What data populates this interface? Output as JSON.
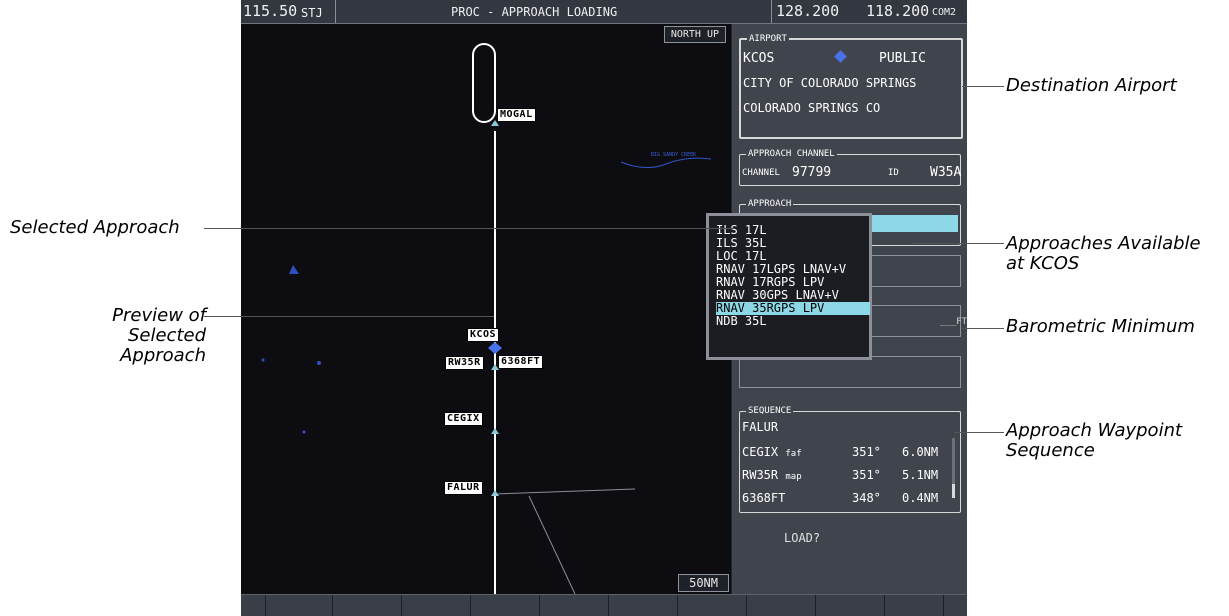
{
  "top_bar": {
    "nav_freq": "115.50",
    "nav_id": "STJ",
    "title": "PROC - APPROACH LOADING",
    "com_active": "128.200",
    "com_standby": "118.200",
    "com_label": "COM2"
  },
  "map": {
    "orientation": "NORTH UP",
    "range": "50NM",
    "waypoints": {
      "mogal": "MOGAL",
      "kcos": "KCOS",
      "rw35r": "RW35R",
      "elev": "6368FT",
      "cegix": "CEGIX",
      "falur": "FALUR"
    },
    "creek_label": "BIG SANDY CREEK"
  },
  "airport": {
    "title": "AIRPORT",
    "id": "KCOS",
    "type": "PUBLIC",
    "name": "CITY OF COLORADO SPRINGS",
    "city": "COLORADO SPRINGS CO",
    "symbol_color": "#4a72e8"
  },
  "approach_channel": {
    "title": "APPROACH CHANNEL",
    "channel_label": "CHANNEL",
    "channel": "97799",
    "id_label": "ID",
    "id": "W35A"
  },
  "approach": {
    "title": "APPROACH",
    "selected": "RNAV 35RGPS LPV",
    "highlight_color": "#8cd8e6"
  },
  "approach_list": [
    "ILS 17L",
    "ILS 35L",
    "LOC 17L",
    "RNAV 17LGPS LNAV+V",
    "RNAV 17RGPS LPV",
    "RNAV 30GPS LNAV+V",
    "RNAV 35RGPS LPV",
    "NDB 35L"
  ],
  "baro_min_ft_label": "___FT",
  "sequence": {
    "title": "SEQUENCE",
    "rows": [
      {
        "name": "FALUR",
        "type": "",
        "course": "",
        "dist": ""
      },
      {
        "name": "CEGIX",
        "type": "faf",
        "course": "351°",
        "dist": "6.0NM"
      },
      {
        "name": "RW35R",
        "type": "map",
        "course": "351°",
        "dist": "5.1NM"
      },
      {
        "name": "6368FT",
        "type": "",
        "course": "348°",
        "dist": "0.4NM"
      }
    ]
  },
  "load_prompt": "LOAD?",
  "callouts": {
    "destination_airport": "Destination Airport",
    "selected_approach": "Selected Approach",
    "approaches_available_1": "Approaches Available",
    "approaches_available_2": "at KCOS",
    "preview_1": "Preview of",
    "preview_2": "Selected",
    "preview_3": "Approach",
    "baro_min": "Barometric Minimum",
    "waypoint_seq_1": "Approach Waypoint",
    "waypoint_seq_2": "Sequence"
  }
}
